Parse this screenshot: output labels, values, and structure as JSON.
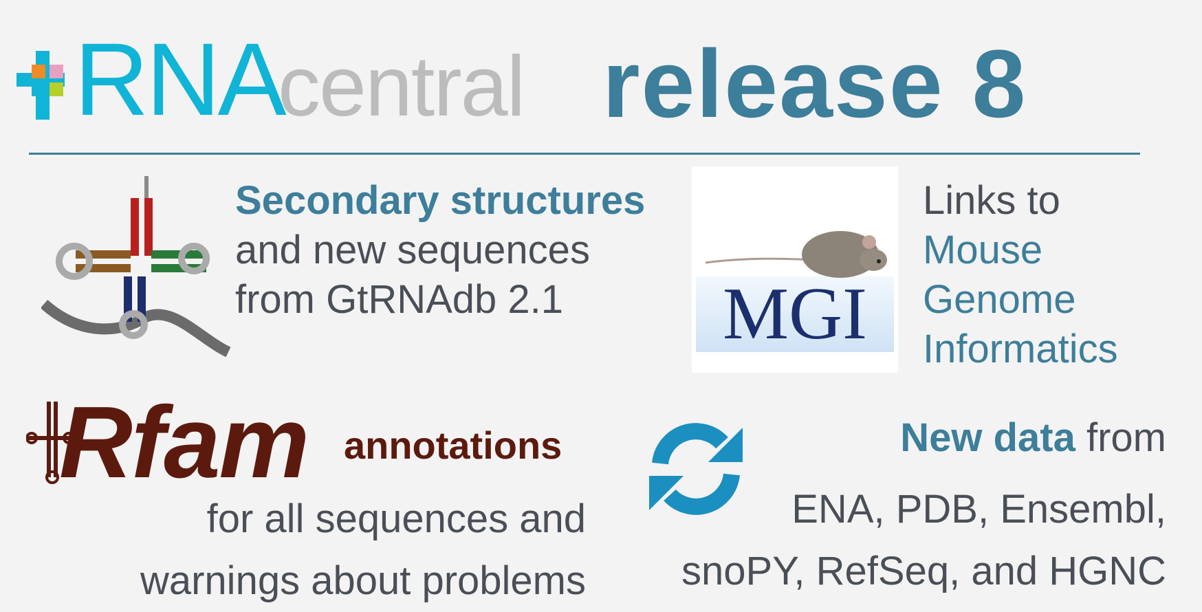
{
  "header": {
    "logo_rna": "RNA",
    "logo_central": "central",
    "release": "release 8"
  },
  "secondary": {
    "title": "Secondary structures",
    "line2": "and new sequences",
    "line3": "from GtRNAdb 2.1"
  },
  "mgi": {
    "logo_text": "MGI",
    "line1": "Links to",
    "line2": "Mouse",
    "line3": "Genome",
    "line4": "Informatics"
  },
  "rfam": {
    "logo_text": "Rfam",
    "title": "annotations",
    "line2": "for all sequences and",
    "line3": "warnings about problems"
  },
  "newdata": {
    "highlight": "New data",
    "from": " from",
    "line2": "ENA, PDB, Ensembl,",
    "line3": "snoPY, RefSeq, and HGNC"
  },
  "colors": {
    "rna_blue": "#10b4d6",
    "accent": "#3d7e9a",
    "rfam_brown": "#5c1a0e",
    "sync_blue": "#1b8fc0",
    "text_gray": "#4a4f57"
  }
}
